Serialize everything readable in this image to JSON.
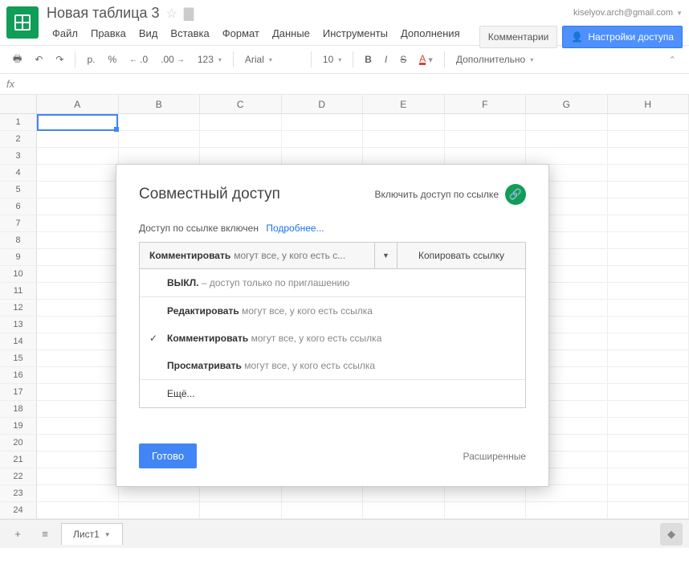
{
  "account": {
    "email": "kiselyov.arch@gmail.com"
  },
  "doc": {
    "title": "Новая таблица 3"
  },
  "menubar": [
    "Файл",
    "Правка",
    "Вид",
    "Вставка",
    "Формат",
    "Данные",
    "Инструменты",
    "Дополнения"
  ],
  "headerButtons": {
    "comments": "Комментарии",
    "share": "Настройки доступа"
  },
  "toolbar": {
    "currency": "р.",
    "percent": "%",
    "dec_dec": ".0",
    "dec_inc": ".00",
    "numfmt": "123",
    "font": "Arial",
    "size": "10",
    "bold": "B",
    "italic": "I",
    "strike": "S",
    "color": "A",
    "more": "Дополнительно"
  },
  "columns": [
    "A",
    "B",
    "C",
    "D",
    "E",
    "F",
    "G",
    "H"
  ],
  "rowCount": 24,
  "sheetTabs": {
    "first": "Лист1"
  },
  "dialog": {
    "title": "Совместный доступ",
    "linkToggle": "Включить доступ по ссылке",
    "linkStatus": "Доступ по ссылке включен",
    "learnMore": "Подробнее...",
    "selectedStrong": "Комментировать",
    "selectedRest": "могут все, у кого есть с...",
    "copyLink": "Копировать ссылку",
    "options": {
      "off_strong": "ВЫКЛ.",
      "off_rest": " – доступ только по приглашению",
      "edit_strong": "Редактировать",
      "edit_rest": " могут все, у кого есть ссылка",
      "comment_strong": "Комментировать",
      "comment_rest": " могут все, у кого есть ссылка",
      "view_strong": "Просматривать",
      "view_rest": " могут все, у кого есть ссылка",
      "more": "Ещё..."
    },
    "done": "Готово",
    "advanced": "Расширенные"
  }
}
